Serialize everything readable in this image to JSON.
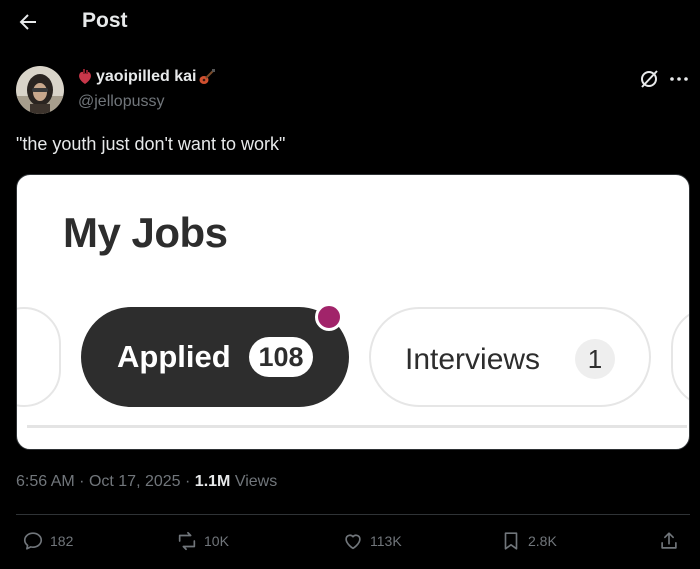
{
  "header": {
    "title": "Post",
    "back_icon": "arrow-left-icon"
  },
  "author": {
    "display_name": "yaoipilled kai",
    "handle": "@jellopussy",
    "name_emojis": [
      "anatomical-heart-emoji",
      "guitar-emoji"
    ]
  },
  "tweet": {
    "text": "\"the youth just don't want to work\""
  },
  "media": {
    "title": "My Jobs",
    "tabs": [
      {
        "label": "Applied",
        "count": "108",
        "active": true,
        "has_dot": true
      },
      {
        "label": "Interviews",
        "count": "1",
        "active": false
      }
    ],
    "colors": {
      "active_pill": "#2d2d2d",
      "dot": "#a1246a"
    }
  },
  "meta": {
    "time": "6:56 AM",
    "date": "Oct 17, 2025",
    "views_count": "1.1M",
    "views_label": "Views"
  },
  "actions": {
    "replies": "182",
    "reposts": "10K",
    "likes": "113K",
    "bookmarks": "2.8K"
  }
}
